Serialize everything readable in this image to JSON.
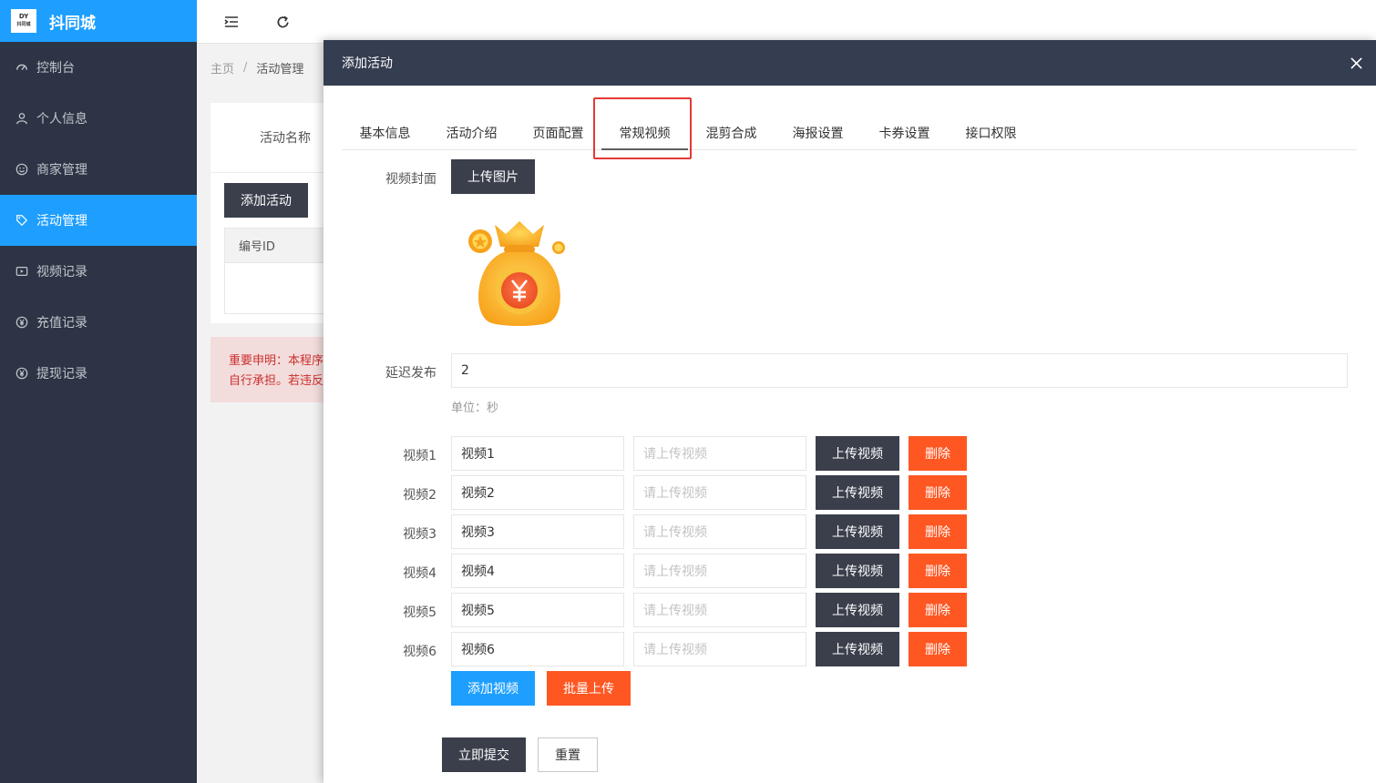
{
  "app": {
    "logo_small_top": "DY",
    "logo_small_bottom": "抖同城",
    "title": "抖同城"
  },
  "sidebar": {
    "items": [
      {
        "label": "控制台",
        "icon": "dashboard-icon"
      },
      {
        "label": "个人信息",
        "icon": "user-icon"
      },
      {
        "label": "商家管理",
        "icon": "smile-icon"
      },
      {
        "label": "活动管理",
        "icon": "tag-icon",
        "active": true
      },
      {
        "label": "视频记录",
        "icon": "video-icon"
      },
      {
        "label": "充值记录",
        "icon": "yen-icon"
      },
      {
        "label": "提现记录",
        "icon": "yen-icon"
      }
    ]
  },
  "breadcrumb": {
    "home": "主页",
    "separator": "/",
    "current": "活动管理"
  },
  "background_page": {
    "filter_label": "活动名称",
    "add_button": "添加活动",
    "table_header_id": "编号ID",
    "notice_line1": "重要申明：本程序",
    "notice_line2": "自行承担。若违反"
  },
  "modal": {
    "title": "添加活动",
    "tabs": [
      "基本信息",
      "活动介绍",
      "页面配置",
      "常规视频",
      "混剪合成",
      "海报设置",
      "卡券设置",
      "接口权限"
    ],
    "active_tab": "常规视频",
    "cover_label": "视频封面",
    "upload_image_button": "上传图片",
    "delay_label": "延迟发布",
    "delay_value": "2",
    "delay_unit": "单位：秒",
    "videos": [
      {
        "label": "视频1",
        "name": "视频1",
        "file_placeholder": "请上传视频"
      },
      {
        "label": "视频2",
        "name": "视频2",
        "file_placeholder": "请上传视频"
      },
      {
        "label": "视频3",
        "name": "视频3",
        "file_placeholder": "请上传视频"
      },
      {
        "label": "视频4",
        "name": "视频4",
        "file_placeholder": "请上传视频"
      },
      {
        "label": "视频5",
        "name": "视频5",
        "file_placeholder": "请上传视频"
      },
      {
        "label": "视频6",
        "name": "视频6",
        "file_placeholder": "请上传视频"
      }
    ],
    "upload_video_button": "上传视频",
    "delete_button": "删除",
    "add_video_button": "添加视频",
    "batch_upload_button": "批量上传",
    "submit_button": "立即提交",
    "reset_button": "重置"
  },
  "colors": {
    "sidebar_bg": "#2c3445",
    "accent_blue": "#1e9fff",
    "danger_orange": "#ff5722",
    "dark_button": "#3a3f4b",
    "modal_header": "#353d50",
    "highlight_red": "#e53935"
  }
}
